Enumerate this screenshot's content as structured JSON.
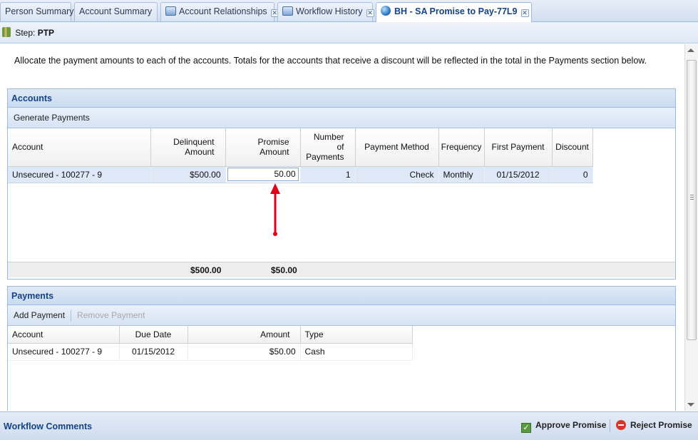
{
  "tabs": [
    {
      "label": "Person Summary",
      "active": false,
      "closable": false
    },
    {
      "label": "Account Summary",
      "active": false,
      "closable": false
    },
    {
      "label": "Account Relationships",
      "active": false,
      "closable": true,
      "icon": "window-icon"
    },
    {
      "label": "Workflow History",
      "active": false,
      "closable": true,
      "icon": "window-icon"
    },
    {
      "label": "BH - SA Promise to Pay-77L9",
      "active": true,
      "closable": true,
      "icon": "globe-icon"
    }
  ],
  "step": {
    "label": "Step:",
    "value": "PTP"
  },
  "intro_text": "Allocate the payment amounts to each of the accounts. Totals for the accounts that receive a discount will be reflected in the total in the Payments section below.",
  "accounts": {
    "title": "Accounts",
    "toolbar": {
      "generate_label": "Generate Payments"
    },
    "columns": {
      "account": "Account",
      "delinquent_1": "Delinquent",
      "delinquent_2": "Amount",
      "promise_1": "Promise",
      "promise_2": "Amount",
      "num_1": "Number",
      "num_2": "of",
      "num_3": "Payments",
      "method": "Payment Method",
      "frequency": "Frequency",
      "first_payment": "First Payment",
      "discount": "Discount"
    },
    "rows": [
      {
        "account": "Unsecured - 100277 - 9",
        "delinquent": "$500.00",
        "promise": "50.00",
        "num_payments": "1",
        "method": "Check",
        "frequency": "Monthly",
        "first_payment": "01/15/2012",
        "discount": "0"
      }
    ],
    "totals": {
      "delinquent": "$500.00",
      "promise": "$50.00"
    }
  },
  "payments": {
    "title": "Payments",
    "toolbar": {
      "add_label": "Add Payment",
      "remove_label": "Remove Payment"
    },
    "columns": {
      "account": "Account",
      "due_date": "Due Date",
      "amount": "Amount",
      "type": "Type"
    },
    "rows": [
      {
        "account": "Unsecured - 100277 - 9",
        "due_date": "01/15/2012",
        "amount": "$50.00",
        "type": "Cash"
      }
    ]
  },
  "footer": {
    "workflow_comments": "Workflow Comments",
    "approve_label": "Approve Promise",
    "reject_label": "Reject Promise"
  },
  "colors": {
    "accent": "#15428b",
    "annotation_arrow": "#e0001a"
  }
}
